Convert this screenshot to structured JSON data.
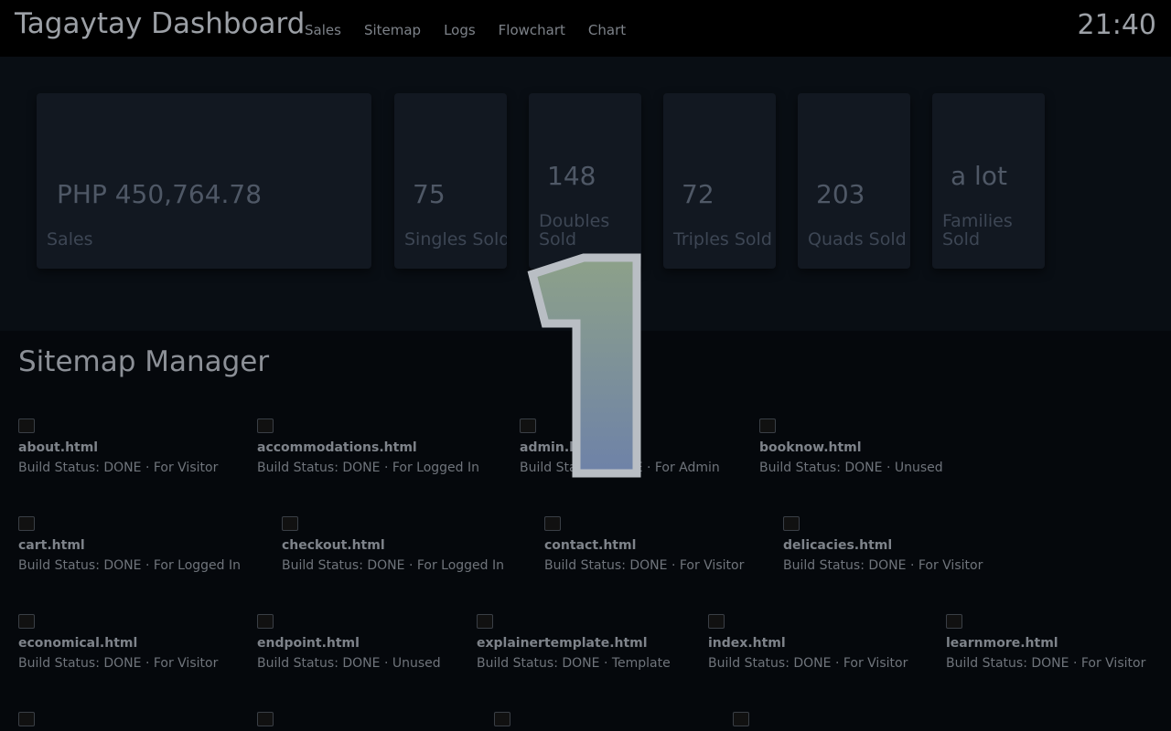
{
  "header": {
    "title": "Tagaytay Dashboard",
    "nav": [
      "Sales",
      "Sitemap",
      "Logs",
      "Flowchart",
      "Chart"
    ],
    "clock": "21:40"
  },
  "stats": [
    {
      "value": "PHP 450,764.78",
      "label": "Sales"
    },
    {
      "value": "75",
      "label": "Singles Sold"
    },
    {
      "value": "148",
      "label": "Doubles Sold"
    },
    {
      "value": "72",
      "label": "Triples Sold"
    },
    {
      "value": "203",
      "label": "Quads Sold"
    },
    {
      "value": "a lot",
      "label": "Families Sold"
    }
  ],
  "sitemap": {
    "title": "Sitemap Manager",
    "files": [
      {
        "name": "about.html",
        "status": "Build Status: DONE · For Visitor"
      },
      {
        "name": "accommodations.html",
        "status": "Build Status: DONE · For Logged In"
      },
      {
        "name": "admin.html",
        "status": "Build Status: DONE · For Admin"
      },
      {
        "name": "booknow.html",
        "status": "Build Status: DONE · Unused"
      },
      {
        "name": "cart.html",
        "status": "Build Status: DONE · For Logged In"
      },
      {
        "name": "checkout.html",
        "status": "Build Status: DONE · For Logged In"
      },
      {
        "name": "contact.html",
        "status": "Build Status: DONE · For Visitor"
      },
      {
        "name": "delicacies.html",
        "status": "Build Status: DONE · For Visitor"
      },
      {
        "name": "economical.html",
        "status": "Build Status: DONE · For Visitor"
      },
      {
        "name": "endpoint.html",
        "status": "Build Status: DONE · Unused"
      },
      {
        "name": "explainertemplate.html",
        "status": "Build Status: DONE · Template"
      },
      {
        "name": "index.html",
        "status": "Build Status: DONE · For Visitor"
      },
      {
        "name": "learnmore.html",
        "status": "Build Status: DONE · For Visitor"
      }
    ]
  },
  "overlay": {
    "countdown": "1"
  }
}
